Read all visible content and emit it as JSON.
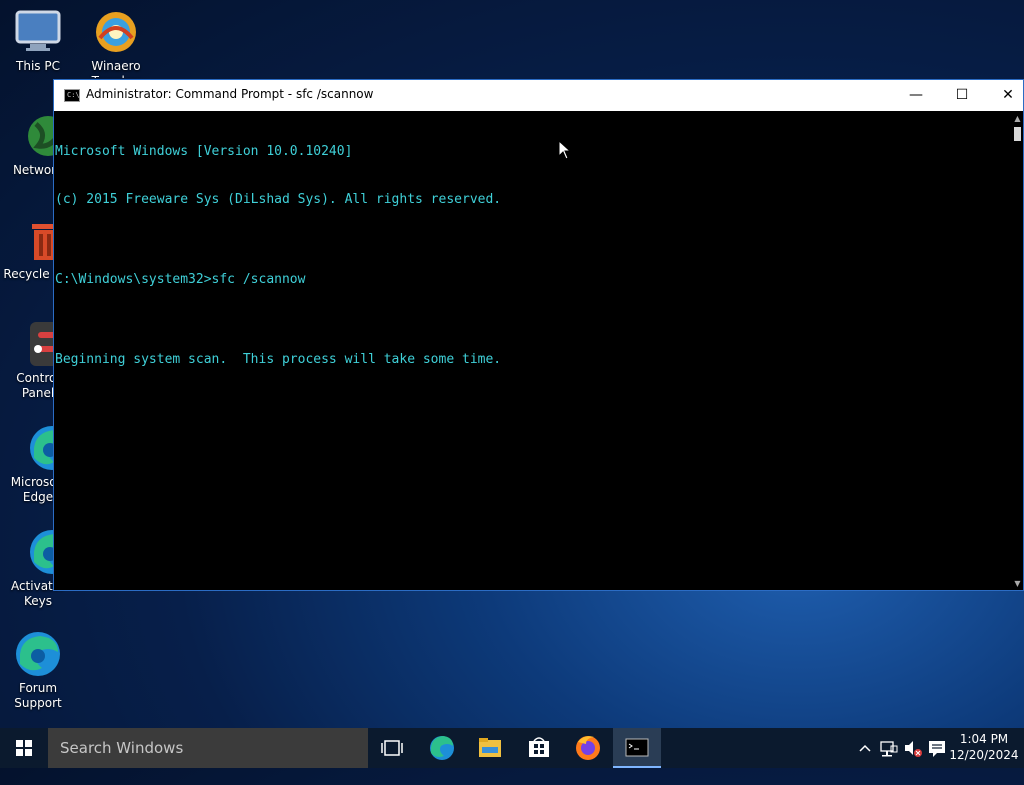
{
  "desktop": {
    "icons": [
      {
        "label": "This PC",
        "icon": "monitor-icon"
      },
      {
        "label": "Winaero Tweaker",
        "icon": "winaero-icon"
      },
      {
        "label": "Network",
        "icon": "network-globe-icon"
      },
      {
        "label": "Recycle Bin",
        "icon": "recycle-bin-icon"
      },
      {
        "label": "Control Panel",
        "icon": "control-panel-icon"
      },
      {
        "label": "Microsoft Edge",
        "icon": "edge-icon"
      },
      {
        "label": "Activator Keys",
        "icon": "edge-icon"
      },
      {
        "label": "Forum Support",
        "icon": "edge-icon"
      }
    ]
  },
  "window": {
    "title": "Administrator: Command Prompt - sfc  /scannow",
    "controls": {
      "minimize": "—",
      "maximize": "☐",
      "close": "✕"
    },
    "console_lines": [
      "Microsoft Windows [Version 10.0.10240]",
      "(c) 2015 Freeware Sys (DiLshad Sys). All rights reserved.",
      "",
      "C:\\Windows\\system32>sfc /scannow",
      "",
      "Beginning system scan.  This process will take some time."
    ]
  },
  "taskbar": {
    "search_placeholder": "Search Windows",
    "apps": [
      "task-view-icon",
      "edge-icon",
      "file-explorer-icon",
      "store-icon",
      "firefox-icon",
      "command-prompt-icon"
    ],
    "tray": {
      "chevron": "^",
      "time": "1:04 PM",
      "date": "12/20/2024"
    }
  },
  "colors": {
    "console_text": "#3fd0d8",
    "accent": "#2b6cc4"
  }
}
